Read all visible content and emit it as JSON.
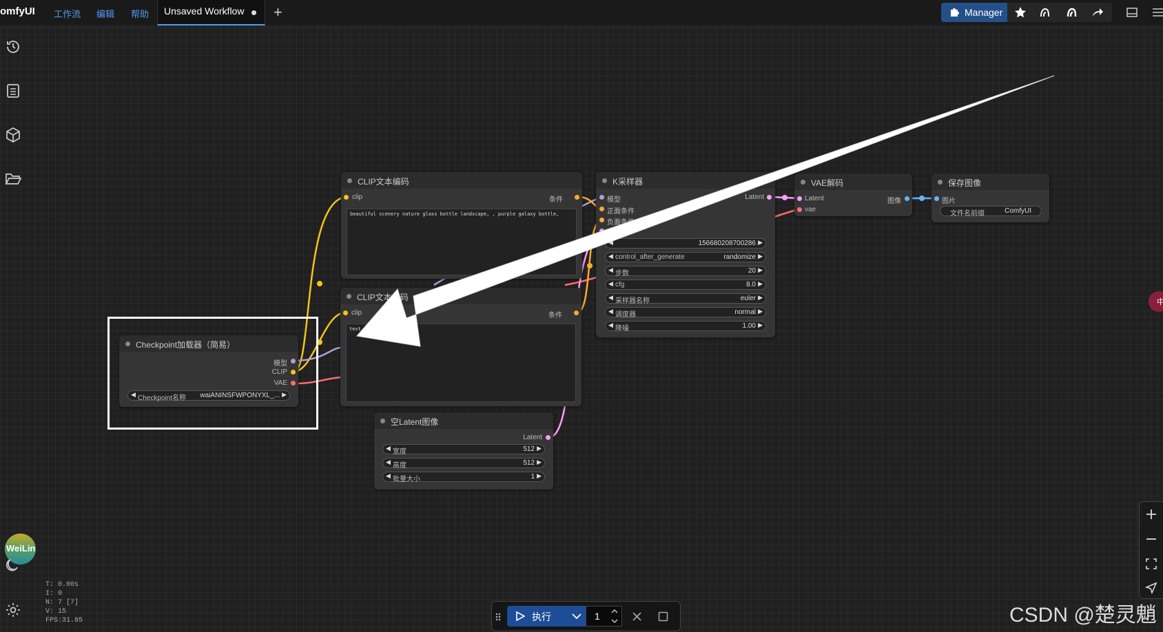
{
  "app": {
    "brand": "omfyUI",
    "menu": [
      "工作流",
      "编辑",
      "帮助"
    ],
    "tab_title": "Unsaved Workflow",
    "manager_label": "Manager"
  },
  "nodes": {
    "clip_top": {
      "title": "CLIP文本编码",
      "input": "clip",
      "output": "条件",
      "text": "beautiful scenery nature glass bottle landscape, , purple galaxy bottle,"
    },
    "clip_bottom": {
      "title": "CLIP文本编码",
      "input": "clip",
      "output": "条件",
      "text": "text,"
    },
    "ksampler": {
      "title": "K采样器",
      "inputs": [
        "模型",
        "正面条件",
        "负面条件"
      ],
      "output": "Latent",
      "widgets": [
        {
          "label": "",
          "value": "156680208700286"
        },
        {
          "label": "control_after_generate",
          "value": "randomize"
        },
        {
          "label": "步数",
          "value": "20"
        },
        {
          "label": "cfg",
          "value": "8.0"
        },
        {
          "label": "采样器名称",
          "value": "euler"
        },
        {
          "label": "调度器",
          "value": "normal"
        },
        {
          "label": "降噪",
          "value": "1.00"
        }
      ]
    },
    "vae": {
      "title": "VAE解码",
      "inputs": [
        "Latent",
        "vae"
      ],
      "output": "图像"
    },
    "save": {
      "title": "保存图像",
      "input": "图片",
      "widget_label": "文件名前缀",
      "widget_value": "ComfyUI"
    },
    "checkpoint": {
      "title": "Checkpoint加载器（简易）",
      "outputs": [
        "模型",
        "CLIP",
        "VAE"
      ],
      "widget_label": "Checkpoint名称",
      "widget_value": "waiANINSFWPONYXL_..."
    },
    "latent": {
      "title": "空Latent图像",
      "output": "Latent",
      "widgets": [
        {
          "label": "宽度",
          "value": "512"
        },
        {
          "label": "高度",
          "value": "512"
        },
        {
          "label": "批量大小",
          "value": "1"
        }
      ]
    }
  },
  "stats": [
    "T: 0.00s",
    "I: 0",
    "N: 7 [7]",
    "V: 15",
    "FPS:31.85"
  ],
  "user_badge": "WeiLin",
  "run": {
    "label": "执行",
    "batch_count": "1"
  },
  "right_edge_badge": "中",
  "watermark": "CSDN @楚灵魈",
  "colors": {
    "accent_blue": "#4e9cf0",
    "clip_wire": "#f5c518",
    "model_wire": "#b39ddb",
    "vae_wire": "#ff6e6e",
    "latent_wire": "#ff9cf9",
    "image_wire": "#64b5f6",
    "cond_wire": "#ffa931",
    "highlight_box": "#ffffff"
  }
}
